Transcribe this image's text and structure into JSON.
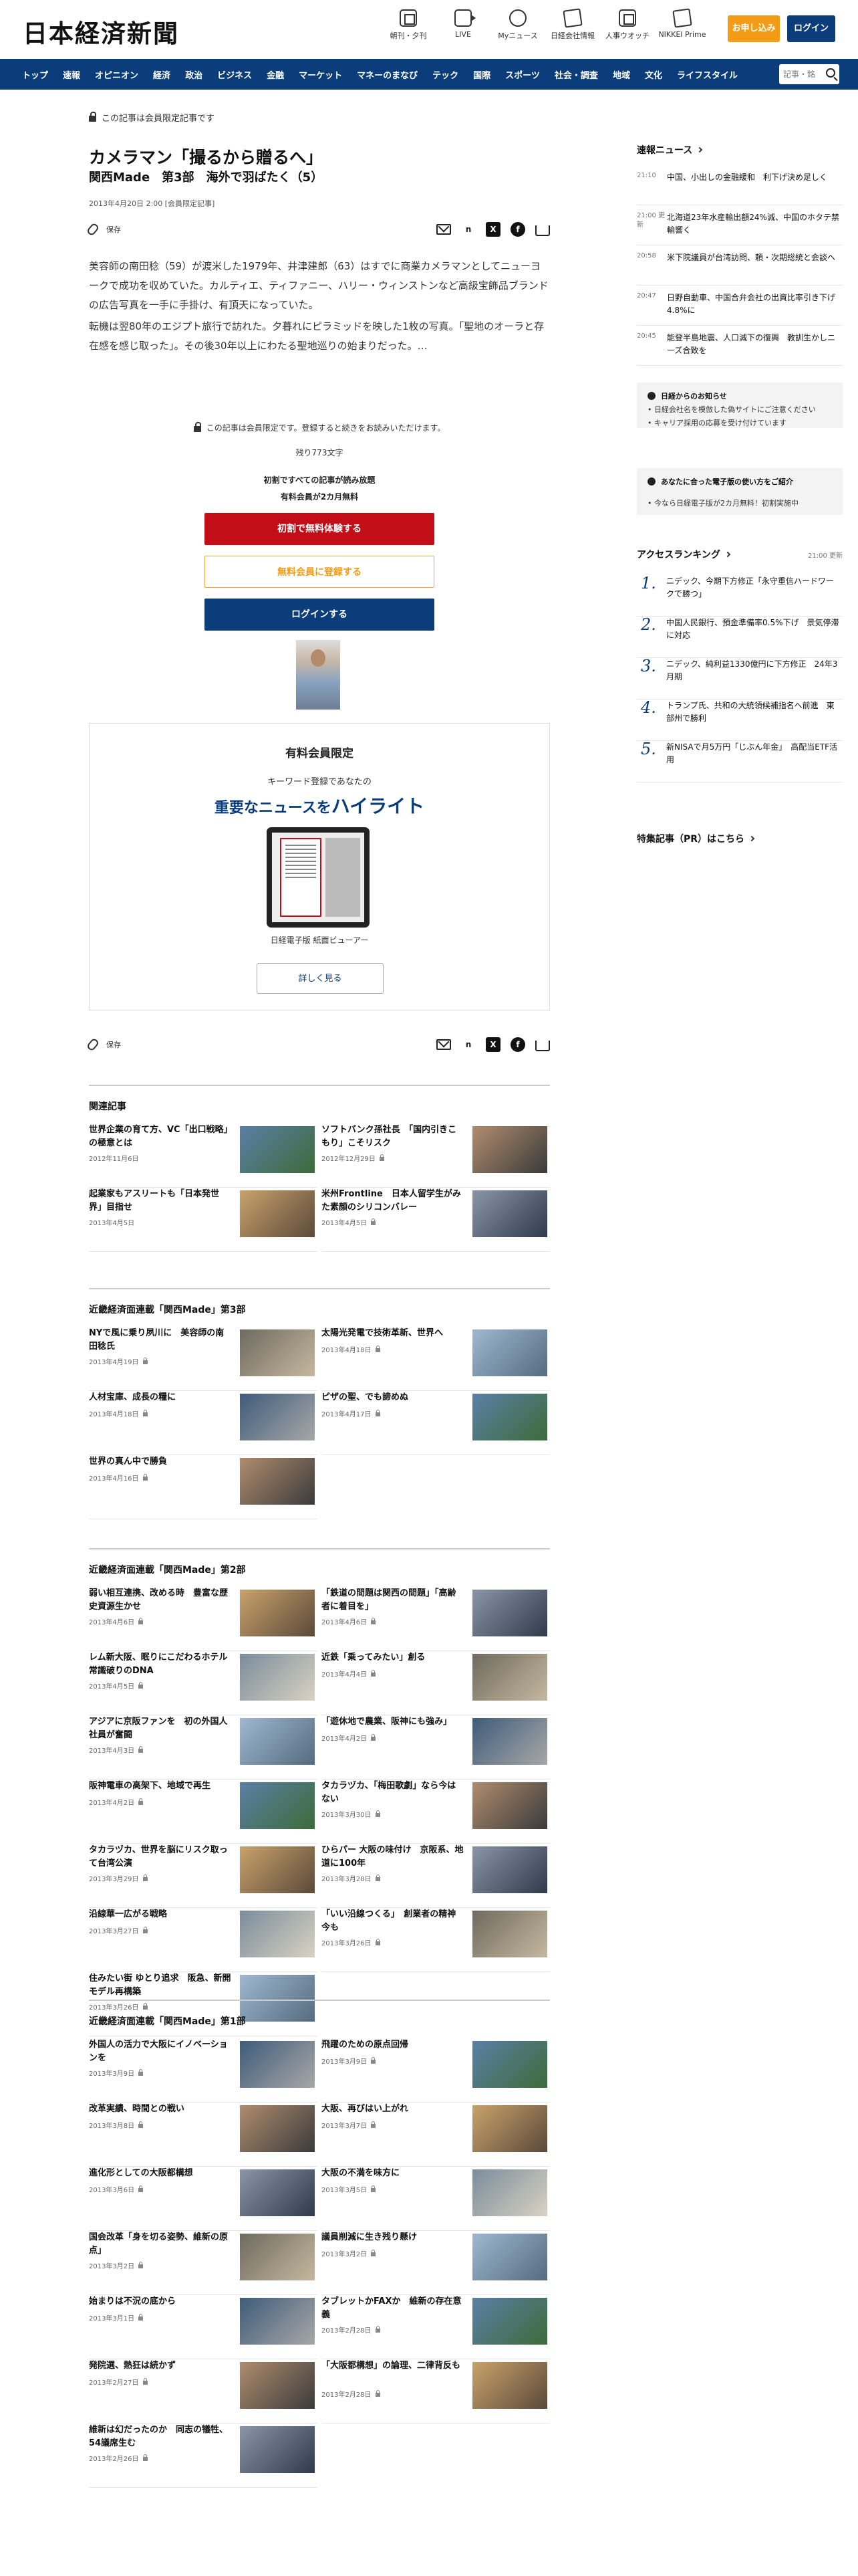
{
  "header": {
    "logo": "日本経済新聞",
    "icons": [
      {
        "label": "朝刊・夕刊",
        "icon": "newspaper-icon"
      },
      {
        "label": "LIVE",
        "icon": "video-camera-icon"
      },
      {
        "label": "Myニュース",
        "icon": "user-icon"
      },
      {
        "label": "日経会社情報",
        "icon": "pen-icon"
      },
      {
        "label": "人事ウオッチ",
        "icon": "person-square-icon"
      },
      {
        "label": "NIKKEI Prime",
        "icon": "prime-icon"
      }
    ],
    "subscribe": "お申し込み",
    "login": "ログイン"
  },
  "nav": {
    "items": [
      "トップ",
      "速報",
      "オピニオン",
      "経済",
      "政治",
      "ビジネス",
      "金融",
      "マーケット",
      "マネーのまなび",
      "テック",
      "国際",
      "スポーツ",
      "社会・調査",
      "地域",
      "文化",
      "ライフスタイル"
    ],
    "search_placeholder": "記事・銘"
  },
  "article": {
    "lock_notice": "この記事は会員限定記事です",
    "title": "カメラマン「撮るから贈るへ」",
    "subtitle": "関西Made　第3部　海外で羽ばたく（5）",
    "date": "2013年4月20日 2:00 [会員限定記事]",
    "save_label": "保存",
    "share_n": "n",
    "share_x": "X",
    "share_fb": "f",
    "body1": "美容師の南田稔（59）が渡米した1979年、井津建郎（63）はすでに商業カメラマンとしてニューヨークで成功を収めていた。カルティエ、ティファニー、ハリー・ウィンストンなど高級宝飾品ブランドの広告写真を一手に手掛け、有頂天になっていた。",
    "body2": "転機は翌80年のエジプト旅行で訪れた。夕暮れにピラミッドを映した1枚の写真。「聖地のオーラと存在感を感じ取った」。その後30年以上にわたる聖地巡りの始まりだった。…"
  },
  "paywall": {
    "notice": "この記事は会員限定です。登録すると続きをお読みいただけます。",
    "remaining": "残り773文字",
    "line1": "初割ですべての記事が読み放題",
    "line2": "有料会員が2カ月無料",
    "btn_trial": "初割で無料体験する",
    "btn_free": "無料会員に登録する",
    "btn_login": "ログインする"
  },
  "promo": {
    "heading": "有料会員限定",
    "kw": "キーワード登録であなたの",
    "hl_pre": "重要なニュースを",
    "hl_big": "ハイライト",
    "caption": "日経電子版 紙面ビューアー",
    "more": "詳しく見る"
  },
  "sections": [
    {
      "title": "関連記事",
      "items": [
        {
          "title": "世界企業の育て方、VC「出口戦略」の極意とは",
          "date": "2012年11月6日",
          "lock": false
        },
        {
          "title": "ソフトバンク孫社長　「国内引きこもり」こそリスク",
          "date": "2012年12月29日",
          "lock": true
        },
        {
          "title": "起業家もアスリートも「日本発世界」目指せ",
          "date": "2013年4月5日",
          "lock": false
        },
        {
          "title": "米州Frontline　日本人留学生がみた素顔のシリコンバレー",
          "date": "2013年4月5日",
          "lock": true
        }
      ]
    },
    {
      "title": "近畿経済面連載「関西Made」第3部",
      "items": [
        {
          "title": "NYで風に乗り夙川に　美容師の南田稔氏",
          "date": "2013年4月19日",
          "lock": true
        },
        {
          "title": "太陽光発電で技術革新、世界へ",
          "date": "2013年4月18日",
          "lock": true
        },
        {
          "title": "人材宝庫、成長の糧に",
          "date": "2013年4月18日",
          "lock": true
        },
        {
          "title": "ピザの聖、でも諦めぬ",
          "date": "2013年4月17日",
          "lock": true
        },
        {
          "title": "世界の真ん中で勝負",
          "date": "2013年4月16日",
          "lock": true
        }
      ]
    },
    {
      "title": "近畿経済面連載「関西Made」第2部",
      "items": [
        {
          "title": "弱い相互連携、改める時　豊富な歴史資源生かせ",
          "date": "2013年4月6日",
          "lock": true
        },
        {
          "title": "「鉄道の問題は関西の問題」「高齢者に着目を」",
          "date": "2013年4月6日",
          "lock": true
        },
        {
          "title": "レム新大阪、眠りにこだわるホテル　常識破りのDNA",
          "date": "2013年4月5日",
          "lock": true
        },
        {
          "title": "近鉄「乗ってみたい」創る",
          "date": "2013年4月4日",
          "lock": true
        },
        {
          "title": "アジアに京阪ファンを　初の外国人社員が奮闘",
          "date": "2013年4月3日",
          "lock": true
        },
        {
          "title": "「遊休地で農業、阪神にも強み」",
          "date": "2013年4月2日",
          "lock": true
        },
        {
          "title": "阪神電車の高架下、地域で再生",
          "date": "2013年4月2日",
          "lock": true
        },
        {
          "title": "タカラヅカ、「梅田歌劇」なら今はない",
          "date": "2013年3月30日",
          "lock": true
        },
        {
          "title": "タカラヅカ、世界を脳にリスク取って台湾公演",
          "date": "2013年3月29日",
          "lock": true
        },
        {
          "title": "ひらパー 大阪の味付け　京阪系、地道に100年",
          "date": "2013年3月28日",
          "lock": true
        },
        {
          "title": "沿線華一広がる戦略",
          "date": "2013年3月27日",
          "lock": true
        },
        {
          "title": "「いい沿線つくる」　創業者の精神今も",
          "date": "2013年3月26日",
          "lock": true
        },
        {
          "title": "住みたい街 ゆとり追求　阪急、新開モデル再構築",
          "date": "2013年3月26日",
          "lock": true
        }
      ]
    },
    {
      "title": "近畿経済面連載「関西Made」第1部",
      "items": [
        {
          "title": "外国人の活力で大阪にイノベーションを",
          "date": "2013年3月9日",
          "lock": true
        },
        {
          "title": "飛躍のための原点回帰",
          "date": "2013年3月9日",
          "lock": true
        },
        {
          "title": "改革実績、時間との戦い",
          "date": "2013年3月8日",
          "lock": true
        },
        {
          "title": "大阪、再びはい上がれ",
          "date": "2013年3月7日",
          "lock": true
        },
        {
          "title": "進化形としての大阪都構想",
          "date": "2013年3月6日",
          "lock": true
        },
        {
          "title": "大阪の不満を味方に",
          "date": "2013年3月5日",
          "lock": true
        },
        {
          "title": "国会改革「身を切る姿勢、維新の原点」",
          "date": "2013年3月2日",
          "lock": true
        },
        {
          "title": "議員削減に生き残り懸け",
          "date": "2013年3月2日",
          "lock": true
        },
        {
          "title": "始まりは不況の底から",
          "date": "2013年3月1日",
          "lock": true
        },
        {
          "title": "タブレットかFAXか　維新の存在意義",
          "date": "2013年2月28日",
          "lock": true
        },
        {
          "title": "発院選、熱狂は続かず",
          "date": "2013年2月27日",
          "lock": true
        },
        {
          "title": "「大阪都構想」の論理、二律背反も",
          "date": "2013年2月28日",
          "lock": true
        },
        {
          "title": "維新は幻だったのか　同志の犠牲、54議席生む",
          "date": "2013年2月26日",
          "lock": true
        }
      ]
    }
  ],
  "sidebar": {
    "breaking_title": "速報ニュース",
    "news": [
      {
        "time": "21:10",
        "text": "中国、小出しの金融緩和　利下げ決め足しく"
      },
      {
        "time": "21:00 更新",
        "text": "北海道23年水産輸出額24%減、中国のホタテ禁輸響く"
      },
      {
        "time": "20:58",
        "text": "米下院議員が台湾訪問、頼・次期総統と会談へ"
      },
      {
        "time": "20:47",
        "text": "日野自動車、中国合弁会社の出資比率引き下げ　4.8%に"
      },
      {
        "time": "20:45",
        "text": "能登半島地震、人口減下の復興　教訓生かしニーズ合致を"
      }
    ],
    "info_title": "日経からのお知らせ",
    "info_items": [
      "日経会社名を模倣した偽サイトにご注意ください",
      "キャリア採用の応募を受け付けています"
    ],
    "paper_title": "あなたに合った電子版の使い方をご紹介",
    "paper_items": [
      "今なら日経電子版が2カ月無料！初割実施中"
    ],
    "ranking_title": "アクセスランキング",
    "ranking_time": "21:00 更新",
    "ranking": [
      {
        "n": "1.",
        "text": "ニデック、今期下方修正「永守重信ハードワークで勝つ」"
      },
      {
        "n": "2.",
        "text": "中国人民銀行、預金準備率0.5%下げ　景気停滞に対応"
      },
      {
        "n": "3.",
        "text": "ニデック、純利益1330億円に下方修正　24年3月期"
      },
      {
        "n": "4.",
        "text": "トランプ氏、共和の大統領候補指名へ前進　東部州で勝利"
      },
      {
        "n": "5.",
        "text": "新NISAで月5万円「じぶん年金」　高配当ETF活用"
      }
    ],
    "pr_title": "特集記事（PR）はこちら"
  }
}
